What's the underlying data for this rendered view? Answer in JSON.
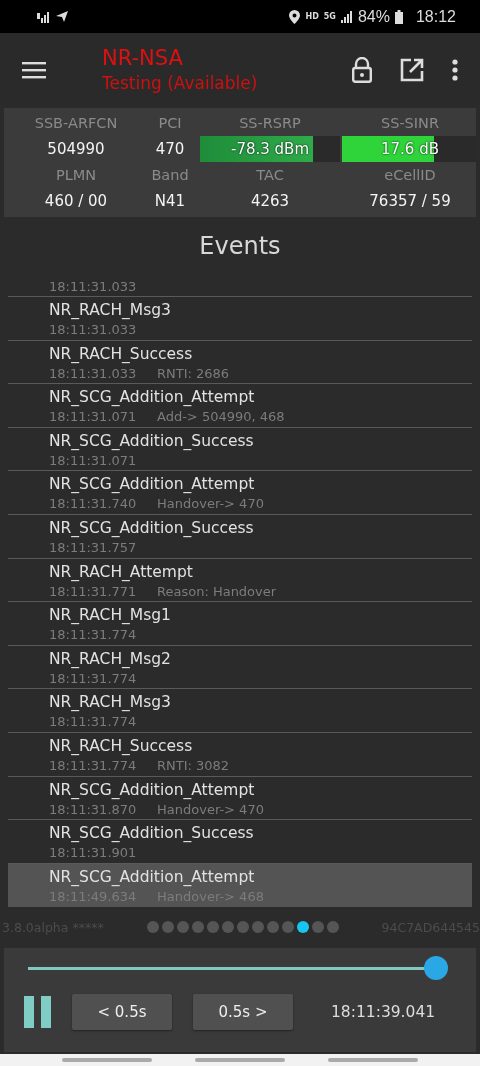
{
  "status_bar": {
    "hd": "HD",
    "network": "5G",
    "battery": "84%",
    "time": "18:12"
  },
  "app_bar": {
    "title": "NR-NSA",
    "subtitle": "Testing (Available)"
  },
  "cell_info": {
    "row1": [
      {
        "label": "SSB-ARFCN",
        "value": "504990",
        "kind": "text"
      },
      {
        "label": "PCI",
        "value": "470",
        "kind": "text"
      },
      {
        "label": "SS-RSRP",
        "value": "-78.3 dBm",
        "kind": "meter",
        "level": 0.81
      },
      {
        "label": "SS-SINR",
        "value": "17.6 dB",
        "kind": "meter",
        "level": 0.68
      }
    ],
    "row2": [
      {
        "label": "PLMN",
        "value": "460 / 00"
      },
      {
        "label": "Band",
        "value": "N41"
      },
      {
        "label": "TAC",
        "value": "4263"
      },
      {
        "label": "eCellID",
        "value": "76357 / 59"
      }
    ]
  },
  "events_title": "Events",
  "events": [
    {
      "time": "18:11:31.033",
      "selected": false
    },
    {
      "name": "NR_RACH_Msg3",
      "time": "18:11:31.033",
      "selected": false
    },
    {
      "name": "NR_RACH_Success",
      "time": "18:11:31.033",
      "detail": "RNTI: 2686",
      "selected": false
    },
    {
      "name": "NR_SCG_Addition_Attempt",
      "time": "18:11:31.071",
      "detail": "Add-> 504990, 468",
      "selected": false
    },
    {
      "name": "NR_SCG_Addition_Success",
      "time": "18:11:31.071",
      "selected": false
    },
    {
      "name": "NR_SCG_Addition_Attempt",
      "time": "18:11:31.740",
      "detail": "Handover-> 470",
      "selected": false
    },
    {
      "name": "NR_SCG_Addition_Success",
      "time": "18:11:31.757",
      "selected": false
    },
    {
      "name": "NR_RACH_Attempt",
      "time": "18:11:31.771",
      "detail": "Reason: Handover",
      "selected": false
    },
    {
      "name": "NR_RACH_Msg1",
      "time": "18:11:31.774",
      "selected": false
    },
    {
      "name": "NR_RACH_Msg2",
      "time": "18:11:31.774",
      "selected": false
    },
    {
      "name": "NR_RACH_Msg3",
      "time": "18:11:31.774",
      "selected": false
    },
    {
      "name": "NR_RACH_Success",
      "time": "18:11:31.774",
      "detail": "RNTI: 3082",
      "selected": false
    },
    {
      "name": "NR_SCG_Addition_Attempt",
      "time": "18:11:31.870",
      "detail": "Handover-> 470",
      "selected": false
    },
    {
      "name": "NR_SCG_Addition_Success",
      "time": "18:11:31.901",
      "selected": false
    },
    {
      "name": "NR_SCG_Addition_Attempt",
      "time": "18:11:49.634",
      "detail": "Handover-> 468",
      "selected": true
    }
  ],
  "footer": {
    "version": "3.8.0alpha *****",
    "device_id": "94C7AD644545",
    "pages": [
      {
        "selected": false
      },
      {
        "selected": false
      },
      {
        "selected": false
      },
      {
        "selected": false
      },
      {
        "selected": false
      },
      {
        "selected": false
      },
      {
        "selected": false
      },
      {
        "selected": false
      },
      {
        "selected": false
      },
      {
        "selected": false
      },
      {
        "selected": true
      },
      {
        "selected": false
      },
      {
        "selected": false
      }
    ]
  },
  "player": {
    "level": 0.98,
    "playing": true,
    "back_button": "< 0.5s",
    "forward_button": "0.5s >",
    "time": "18:11:39.041"
  }
}
